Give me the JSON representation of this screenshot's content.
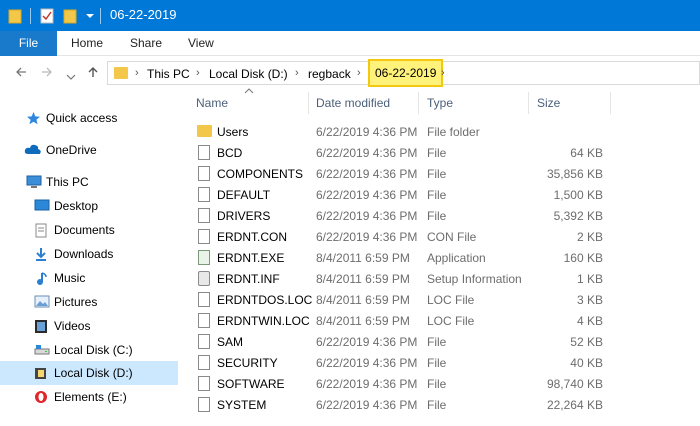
{
  "window": {
    "title": "06-22-2019"
  },
  "ribbon": {
    "tabs": [
      "File",
      "Home",
      "Share",
      "View"
    ]
  },
  "address": {
    "crumbs": [
      "This PC",
      "Local Disk (D:)",
      "regback",
      "06-22-2019"
    ]
  },
  "nav": {
    "items": [
      {
        "label": "Quick access",
        "icon": "star-icon"
      },
      {
        "label": "OneDrive",
        "icon": "cloud-icon"
      },
      {
        "label": "This PC",
        "icon": "computer-icon"
      },
      {
        "label": "Desktop",
        "icon": "desktop-icon"
      },
      {
        "label": "Documents",
        "icon": "documents-icon"
      },
      {
        "label": "Downloads",
        "icon": "download-icon"
      },
      {
        "label": "Music",
        "icon": "music-icon"
      },
      {
        "label": "Pictures",
        "icon": "pictures-icon"
      },
      {
        "label": "Videos",
        "icon": "videos-icon"
      },
      {
        "label": "Local Disk (C:)",
        "icon": "drive-icon"
      },
      {
        "label": "Local Disk (D:)",
        "icon": "drive-icon",
        "selected": true
      },
      {
        "label": "Elements (E:)",
        "icon": "opera-drive-icon"
      }
    ]
  },
  "columns": {
    "name": "Name",
    "date": "Date modified",
    "type": "Type",
    "size": "Size"
  },
  "files": [
    {
      "name": "Users",
      "date": "6/22/2019 4:36 PM",
      "type": "File folder",
      "size": "",
      "icon": "folder-icon"
    },
    {
      "name": "BCD",
      "date": "6/22/2019 4:36 PM",
      "type": "File",
      "size": "64 KB",
      "icon": "file-icon"
    },
    {
      "name": "COMPONENTS",
      "date": "6/22/2019 4:36 PM",
      "type": "File",
      "size": "35,856 KB",
      "icon": "file-icon"
    },
    {
      "name": "DEFAULT",
      "date": "6/22/2019 4:36 PM",
      "type": "File",
      "size": "1,500 KB",
      "icon": "file-icon"
    },
    {
      "name": "DRIVERS",
      "date": "6/22/2019 4:36 PM",
      "type": "File",
      "size": "5,392 KB",
      "icon": "file-icon"
    },
    {
      "name": "ERDNT.CON",
      "date": "6/22/2019 4:36 PM",
      "type": "CON File",
      "size": "2 KB",
      "icon": "file-icon"
    },
    {
      "name": "ERDNT.EXE",
      "date": "8/4/2011 6:59 PM",
      "type": "Application",
      "size": "160 KB",
      "icon": "exe-icon"
    },
    {
      "name": "ERDNT.INF",
      "date": "8/4/2011 6:59 PM",
      "type": "Setup Information",
      "size": "1 KB",
      "icon": "gear-file-icon"
    },
    {
      "name": "ERDNTDOS.LOC",
      "date": "8/4/2011 6:59 PM",
      "type": "LOC File",
      "size": "3 KB",
      "icon": "file-icon"
    },
    {
      "name": "ERDNTWIN.LOC",
      "date": "8/4/2011 6:59 PM",
      "type": "LOC File",
      "size": "4 KB",
      "icon": "file-icon"
    },
    {
      "name": "SAM",
      "date": "6/22/2019 4:36 PM",
      "type": "File",
      "size": "52 KB",
      "icon": "file-icon"
    },
    {
      "name": "SECURITY",
      "date": "6/22/2019 4:36 PM",
      "type": "File",
      "size": "40 KB",
      "icon": "file-icon"
    },
    {
      "name": "SOFTWARE",
      "date": "6/22/2019 4:36 PM",
      "type": "File",
      "size": "98,740 KB",
      "icon": "file-icon"
    },
    {
      "name": "SYSTEM",
      "date": "6/22/2019 4:36 PM",
      "type": "File",
      "size": "22,264 KB",
      "icon": "file-icon"
    }
  ],
  "colors": {
    "titlebar": "#0078d7",
    "file_tab": "#1979ca",
    "selected_nav": "#cce8ff",
    "highlight": "#fff27a"
  }
}
